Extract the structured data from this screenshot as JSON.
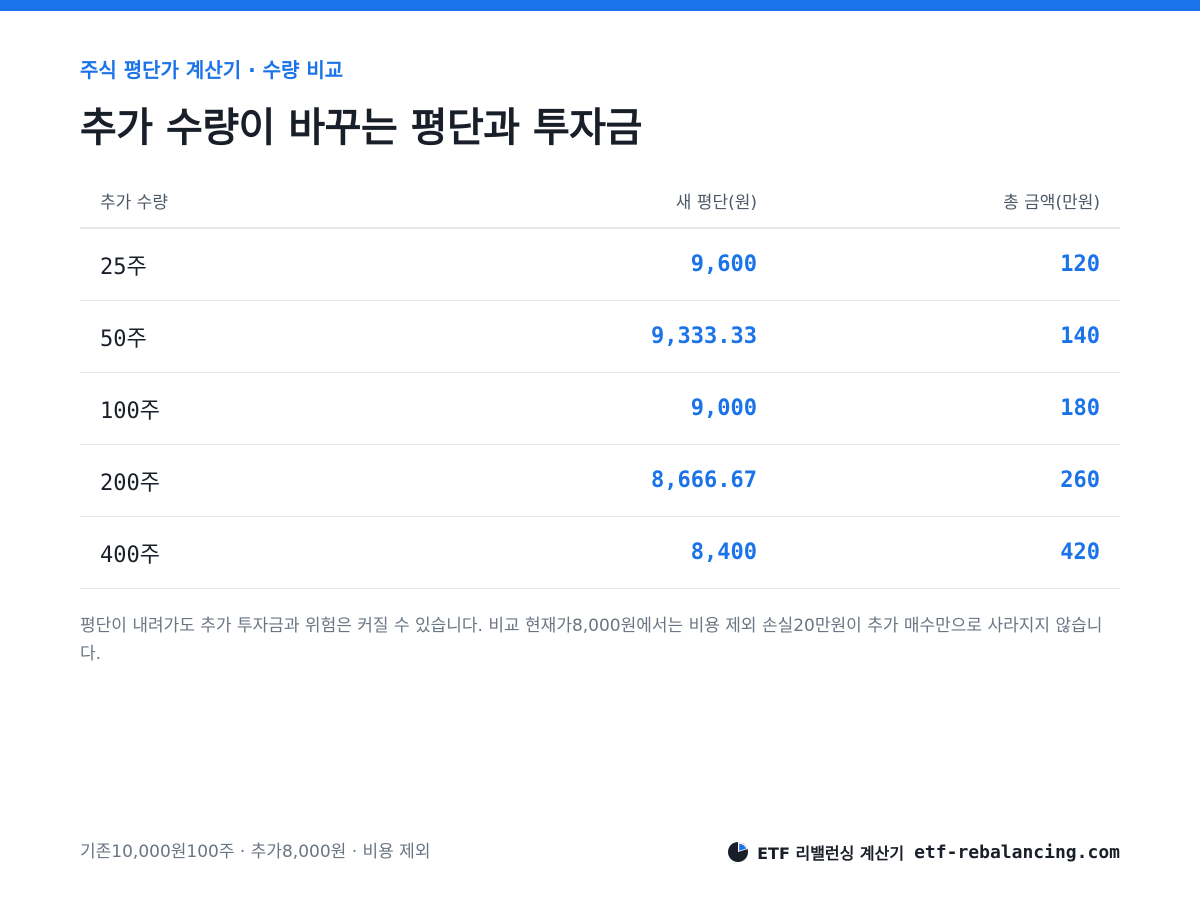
{
  "header": {
    "eyebrow": "주식 평단가 계산기 · 수량 비교",
    "title": "추가 수량이 바꾸는 평단과 투자금"
  },
  "table": {
    "columns": [
      "추가 수량",
      "새 평단(원)",
      "총 금액(만원)"
    ],
    "rows": [
      {
        "qty": "25주",
        "avg": "9,600",
        "total": "120"
      },
      {
        "qty": "50주",
        "avg": "9,333.33",
        "total": "140"
      },
      {
        "qty": "100주",
        "avg": "9,000",
        "total": "180"
      },
      {
        "qty": "200주",
        "avg": "8,666.67",
        "total": "260"
      },
      {
        "qty": "400주",
        "avg": "8,400",
        "total": "420"
      }
    ]
  },
  "note": "평단이 내려가도 추가 투자금과 위험은 커질 수 있습니다. 비교 현재가8,000원에서는 비용 제외 손실20만원이 추가 매수만으로 사라지지 않습니다.",
  "footer": {
    "assumptions": "기존10,000원100주 · 추가8,000원 · 비용 제외",
    "brand_name": "ETF 리밸런싱 계산기",
    "brand_url": "etf-rebalancing.com",
    "logo_icon": "pie-chart-icon"
  },
  "colors": {
    "accent": "#1a73e8",
    "text": "#191f28",
    "muted": "#6b7684",
    "divider": "#e5e8eb"
  }
}
